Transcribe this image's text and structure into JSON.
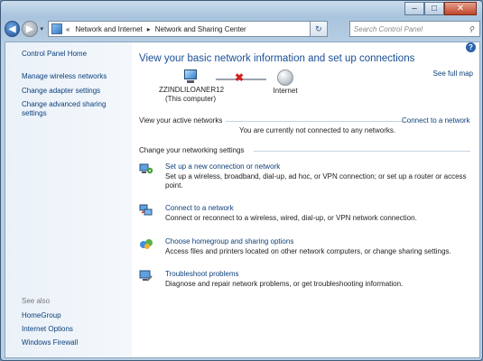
{
  "window": {
    "caption_buttons": {
      "minimize": "–",
      "maximize": "□",
      "close": "✕"
    }
  },
  "nav": {
    "back_icon": "back-arrow-icon",
    "forward_icon": "forward-arrow-icon",
    "history_glyph": "▾",
    "chevrons": "«",
    "breadcrumb": [
      "Network and Internet",
      "Network and Sharing Center"
    ],
    "separator": "▸",
    "refresh_glyph": "↻",
    "search_placeholder": "Search Control Panel",
    "search_glyph": "⚲"
  },
  "sidebar": {
    "home": "Control Panel Home",
    "links": [
      "Manage wireless networks",
      "Change adapter settings",
      "Change advanced sharing settings"
    ],
    "see_also_label": "See also",
    "see_also": [
      "HomeGroup",
      "Internet Options",
      "Windows Firewall"
    ]
  },
  "main": {
    "help_glyph": "?",
    "title": "View your basic network information and set up connections",
    "full_map": "See full map",
    "computer_name": "ZZINDLILOANER12",
    "computer_sub": "(This computer)",
    "internet_label": "Internet",
    "broken_glyph": "✖",
    "active_networks_label": "View your active networks",
    "active_networks_status": "You are currently not connected to any networks.",
    "connect_link": "Connect to a network",
    "change_settings_label": "Change your networking settings",
    "tasks": [
      {
        "title": "Set up a new connection or network",
        "desc": "Set up a wireless, broadband, dial-up, ad hoc, or VPN connection; or set up a router or access point."
      },
      {
        "title": "Connect to a network",
        "desc": "Connect or reconnect to a wireless, wired, dial-up, or VPN network connection."
      },
      {
        "title": "Choose homegroup and sharing options",
        "desc": "Access files and printers located on other network computers, or change sharing settings."
      },
      {
        "title": "Troubleshoot problems",
        "desc": "Diagnose and repair network problems, or get troubleshooting information."
      }
    ]
  },
  "colors": {
    "link": "#0c3f7a",
    "title": "#1a4f94",
    "error": "#d21f1f"
  }
}
